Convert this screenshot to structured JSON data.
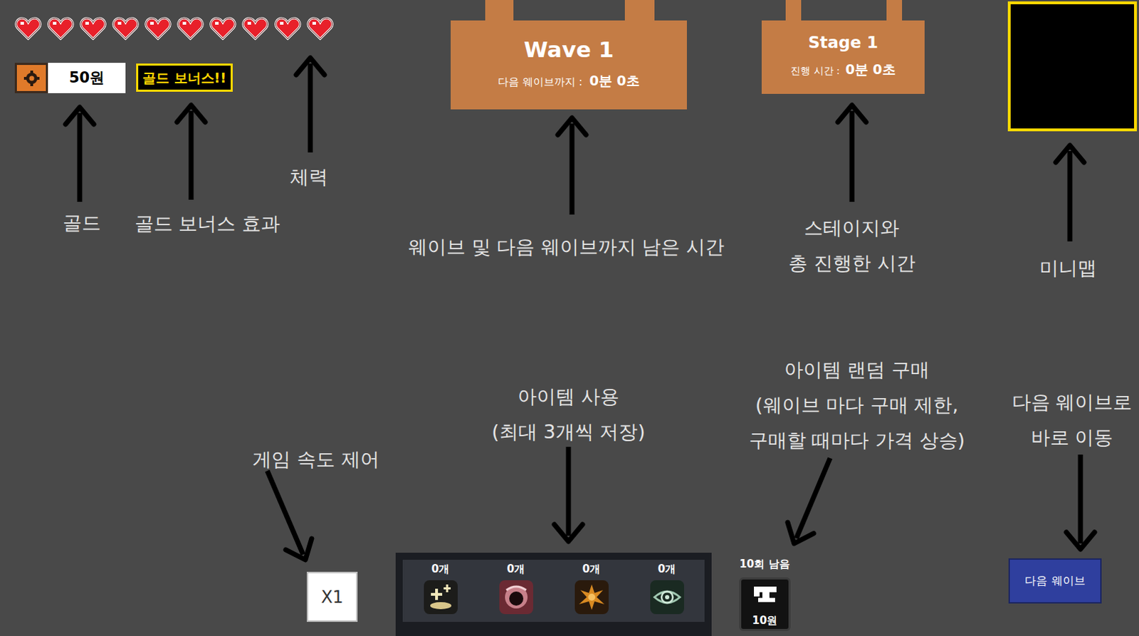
{
  "hud": {
    "hearts": [
      {
        "filled": true
      },
      {
        "filled": true
      },
      {
        "filled": true
      },
      {
        "filled": true
      },
      {
        "filled": true
      },
      {
        "filled": true
      },
      {
        "filled": true
      },
      {
        "filled": true
      },
      {
        "filled": true
      },
      {
        "filled": true
      }
    ],
    "gold": "50원",
    "gold_bonus": "골드 보너스!!",
    "wave": {
      "title": "Wave 1",
      "label": "다음 웨이브까지 :",
      "time": "0분 0초"
    },
    "stage": {
      "title": "Stage 1",
      "label": "진행 시간 :",
      "time": "0분 0초"
    },
    "speed": "X1",
    "items": [
      {
        "count": "0개",
        "kind": "holy"
      },
      {
        "count": "0개",
        "kind": "vortex"
      },
      {
        "count": "0개",
        "kind": "burst"
      },
      {
        "count": "0개",
        "kind": "eye"
      }
    ],
    "shop": {
      "remaining": "10회 남음",
      "price": "10원"
    },
    "next_wave": "다음 웨이브"
  },
  "annotations": [
    {
      "lines": [
        "골드"
      ]
    },
    {
      "lines": [
        "골드 보너스 효과"
      ]
    },
    {
      "lines": [
        "체력"
      ]
    },
    {
      "lines": [
        "웨이브 및 다음 웨이브까지 남은 시간"
      ]
    },
    {
      "lines": [
        "스테이지와",
        "총 진행한 시간"
      ]
    },
    {
      "lines": [
        "미니맵"
      ]
    },
    {
      "lines": [
        "게임 속도 제어"
      ]
    },
    {
      "lines": [
        "아이템 사용",
        "(최대 3개씩 저장)"
      ]
    },
    {
      "lines": [
        "아이템 랜덤 구매",
        "(웨이브 마다 구매 제한,",
        "구매할 때마다 가격 상승)"
      ]
    },
    {
      "lines": [
        "다음 웨이브로",
        "바로 이동"
      ]
    }
  ]
}
